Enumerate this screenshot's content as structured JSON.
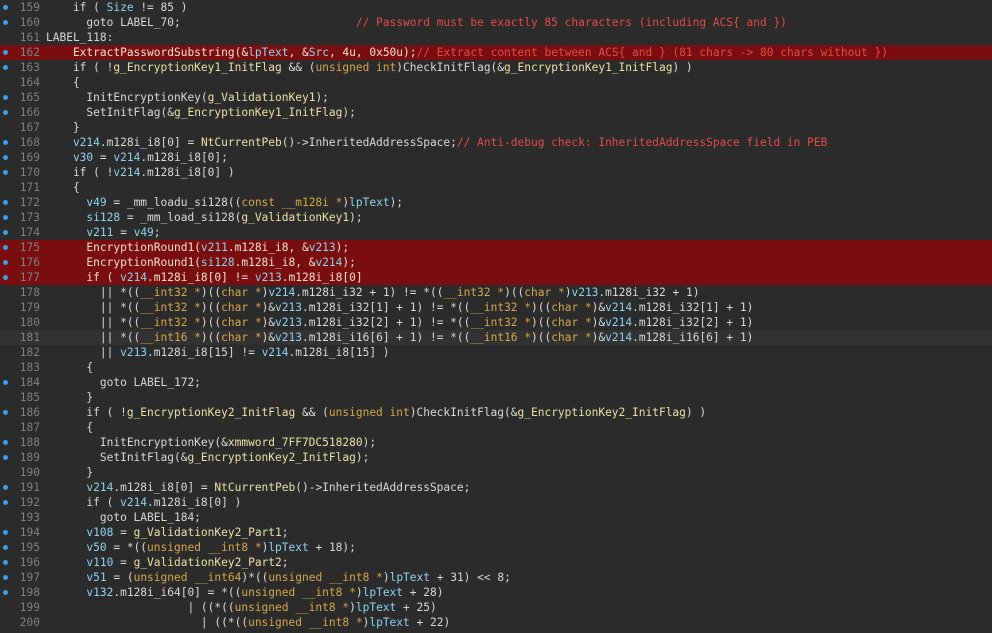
{
  "colors": {
    "background": "#2b2b2b",
    "highlight": "#7a0e0e",
    "line_number": "#7d8084",
    "breakpoint_dot": "#3a9fe6",
    "comment": "#e14c4c",
    "type": "#d4a84b",
    "variable": "#8fd3ef",
    "global": "#e8e2a8"
  },
  "lines": [
    {
      "n": "159",
      "dot": true,
      "hl": false,
      "tokens": [
        [
          "t",
          "    if ( "
        ],
        [
          "v",
          "Size"
        ],
        [
          "t",
          " != 85 )"
        ]
      ]
    },
    {
      "n": "160",
      "dot": true,
      "hl": false,
      "tokens": [
        [
          "t",
          "      goto LABEL_70;                          "
        ],
        [
          "c",
          "// Password must be exactly 85 characters (including ACS{ and })"
        ]
      ]
    },
    {
      "n": "161",
      "dot": false,
      "hl": false,
      "tokens": [
        [
          "t",
          "LABEL_118:"
        ]
      ]
    },
    {
      "n": "162",
      "dot": true,
      "hl": true,
      "tokens": [
        [
          "t",
          "    ExtractPasswordSubstring(&"
        ],
        [
          "v",
          "lpText"
        ],
        [
          "t",
          ", &"
        ],
        [
          "v",
          "Src"
        ],
        [
          "t",
          ", 4u, 0x50u);"
        ],
        [
          "c",
          "// Extract content between ACS{ and } (81 chars -> 80 chars without })"
        ]
      ]
    },
    {
      "n": "163",
      "dot": true,
      "hl": false,
      "tokens": [
        [
          "t",
          "    if ( !"
        ],
        [
          "g",
          "g_EncryptionKey1_InitFlag"
        ],
        [
          "t",
          " && ("
        ],
        [
          "y",
          "unsigned int"
        ],
        [
          "t",
          ")CheckInitFlag(&"
        ],
        [
          "g",
          "g_EncryptionKey1_InitFlag"
        ],
        [
          "t",
          ") )"
        ]
      ]
    },
    {
      "n": "164",
      "dot": false,
      "hl": false,
      "tokens": [
        [
          "t",
          "    {"
        ]
      ]
    },
    {
      "n": "165",
      "dot": true,
      "hl": false,
      "tokens": [
        [
          "t",
          "      InitEncryptionKey("
        ],
        [
          "g",
          "g_ValidationKey1"
        ],
        [
          "t",
          ");"
        ]
      ]
    },
    {
      "n": "166",
      "dot": true,
      "hl": false,
      "tokens": [
        [
          "t",
          "      SetInitFlag(&"
        ],
        [
          "g",
          "g_EncryptionKey1_InitFlag"
        ],
        [
          "t",
          ");"
        ]
      ]
    },
    {
      "n": "167",
      "dot": false,
      "hl": false,
      "tokens": [
        [
          "t",
          "    }"
        ]
      ]
    },
    {
      "n": "168",
      "dot": true,
      "hl": false,
      "tokens": [
        [
          "v",
          "    v214"
        ],
        [
          "t",
          ".m128i_i8[0] = "
        ],
        [
          "g",
          "NtCurrentPeb"
        ],
        [
          "t",
          "()->InheritedAddressSpace;"
        ],
        [
          "c",
          "// Anti-debug check: InheritedAddressSpace field in PEB"
        ]
      ]
    },
    {
      "n": "169",
      "dot": true,
      "hl": false,
      "tokens": [
        [
          "v",
          "    v30"
        ],
        [
          "t",
          " = "
        ],
        [
          "v",
          "v214"
        ],
        [
          "t",
          ".m128i_i8[0];"
        ]
      ]
    },
    {
      "n": "170",
      "dot": true,
      "hl": false,
      "tokens": [
        [
          "t",
          "    if ( !"
        ],
        [
          "v",
          "v214"
        ],
        [
          "t",
          ".m128i_i8[0] )"
        ]
      ]
    },
    {
      "n": "171",
      "dot": false,
      "hl": false,
      "tokens": [
        [
          "t",
          "    {"
        ]
      ]
    },
    {
      "n": "172",
      "dot": true,
      "hl": false,
      "tokens": [
        [
          "v",
          "      v49"
        ],
        [
          "t",
          " = _mm_loadu_si128(("
        ],
        [
          "y",
          "const __m128i *"
        ],
        [
          "t",
          ")"
        ],
        [
          "v",
          "lpText"
        ],
        [
          "t",
          ");"
        ]
      ]
    },
    {
      "n": "173",
      "dot": true,
      "hl": false,
      "tokens": [
        [
          "v",
          "      si128"
        ],
        [
          "t",
          " = _mm_load_si128("
        ],
        [
          "g",
          "g_ValidationKey1"
        ],
        [
          "t",
          ");"
        ]
      ]
    },
    {
      "n": "174",
      "dot": true,
      "hl": false,
      "tokens": [
        [
          "v",
          "      v211"
        ],
        [
          "t",
          " = "
        ],
        [
          "v",
          "v49"
        ],
        [
          "t",
          ";"
        ]
      ]
    },
    {
      "n": "175",
      "dot": true,
      "hl": true,
      "tokens": [
        [
          "t",
          "      EncryptionRound1("
        ],
        [
          "v",
          "v211"
        ],
        [
          "t",
          ".m128i_i8, &"
        ],
        [
          "v",
          "v213"
        ],
        [
          "t",
          ");"
        ]
      ]
    },
    {
      "n": "176",
      "dot": true,
      "hl": true,
      "tokens": [
        [
          "t",
          "      EncryptionRound1("
        ],
        [
          "v",
          "si128"
        ],
        [
          "t",
          ".m128i_i8, &"
        ],
        [
          "v",
          "v214"
        ],
        [
          "t",
          ");"
        ]
      ]
    },
    {
      "n": "177",
      "dot": true,
      "hl": true,
      "tokens": [
        [
          "t",
          "      if ( "
        ],
        [
          "v",
          "v214"
        ],
        [
          "t",
          ".m128i_i8[0] != "
        ],
        [
          "v",
          "v213"
        ],
        [
          "t",
          ".m128i_i8[0]"
        ]
      ]
    },
    {
      "n": "178",
      "dot": false,
      "hl": false,
      "tokens": [
        [
          "t",
          "        || *(("
        ],
        [
          "y",
          "__int32 *"
        ],
        [
          "t",
          ")(("
        ],
        [
          "y",
          "char *"
        ],
        [
          "t",
          ")"
        ],
        [
          "v",
          "v214"
        ],
        [
          "t",
          ".m128i_i32 + 1) != *(("
        ],
        [
          "y",
          "__int32 *"
        ],
        [
          "t",
          ")(("
        ],
        [
          "y",
          "char *"
        ],
        [
          "t",
          ")"
        ],
        [
          "v",
          "v213"
        ],
        [
          "t",
          ".m128i_i32 + 1)"
        ]
      ]
    },
    {
      "n": "179",
      "dot": false,
      "hl": false,
      "tokens": [
        [
          "t",
          "        || *(("
        ],
        [
          "y",
          "__int32 *"
        ],
        [
          "t",
          ")(("
        ],
        [
          "y",
          "char *"
        ],
        [
          "t",
          ")&"
        ],
        [
          "v",
          "v213"
        ],
        [
          "t",
          ".m128i_i32[1] + 1) != *(("
        ],
        [
          "y",
          "__int32 *"
        ],
        [
          "t",
          ")(("
        ],
        [
          "y",
          "char *"
        ],
        [
          "t",
          ")&"
        ],
        [
          "v",
          "v214"
        ],
        [
          "t",
          ".m128i_i32[1] + 1)"
        ]
      ]
    },
    {
      "n": "180",
      "dot": false,
      "hl": false,
      "tokens": [
        [
          "t",
          "        || *(("
        ],
        [
          "y",
          "__int32 *"
        ],
        [
          "t",
          ")(("
        ],
        [
          "y",
          "char *"
        ],
        [
          "t",
          ")&"
        ],
        [
          "v",
          "v213"
        ],
        [
          "t",
          ".m128i_i32[2] + 1) != *(("
        ],
        [
          "y",
          "__int32 *"
        ],
        [
          "t",
          ")(("
        ],
        [
          "y",
          "char *"
        ],
        [
          "t",
          ")&"
        ],
        [
          "v",
          "v214"
        ],
        [
          "t",
          ".m128i_i32[2] + 1)"
        ]
      ]
    },
    {
      "n": "181",
      "dot": false,
      "hl": false,
      "cur": true,
      "tokens": [
        [
          "t",
          "        || *(("
        ],
        [
          "y",
          "__int16 *"
        ],
        [
          "t",
          ")(("
        ],
        [
          "y",
          "char *"
        ],
        [
          "t",
          ")&"
        ],
        [
          "v",
          "v213"
        ],
        [
          "t",
          ".m128i_i16[6] + 1) != *(("
        ],
        [
          "y",
          "__int16 *"
        ],
        [
          "t",
          ")(("
        ],
        [
          "y",
          "char *"
        ],
        [
          "t",
          ")&"
        ],
        [
          "v",
          "v214"
        ],
        [
          "t",
          ".m128i_i16[6] + 1)"
        ]
      ]
    },
    {
      "n": "182",
      "dot": false,
      "hl": false,
      "tokens": [
        [
          "t",
          "        || "
        ],
        [
          "v",
          "v213"
        ],
        [
          "t",
          ".m128i_i8[15] != "
        ],
        [
          "v",
          "v214"
        ],
        [
          "t",
          ".m128i_i8[15] )"
        ]
      ]
    },
    {
      "n": "183",
      "dot": false,
      "hl": false,
      "tokens": [
        [
          "t",
          "      {"
        ]
      ]
    },
    {
      "n": "184",
      "dot": true,
      "hl": false,
      "tokens": [
        [
          "t",
          "        goto LABEL_172;"
        ]
      ]
    },
    {
      "n": "185",
      "dot": false,
      "hl": false,
      "tokens": [
        [
          "t",
          "      }"
        ]
      ]
    },
    {
      "n": "186",
      "dot": true,
      "hl": false,
      "tokens": [
        [
          "t",
          "      if ( !"
        ],
        [
          "g",
          "g_EncryptionKey2_InitFlag"
        ],
        [
          "t",
          " && ("
        ],
        [
          "y",
          "unsigned int"
        ],
        [
          "t",
          ")CheckInitFlag(&"
        ],
        [
          "g",
          "g_EncryptionKey2_InitFlag"
        ],
        [
          "t",
          ") )"
        ]
      ]
    },
    {
      "n": "187",
      "dot": false,
      "hl": false,
      "tokens": [
        [
          "t",
          "      {"
        ]
      ]
    },
    {
      "n": "188",
      "dot": true,
      "hl": false,
      "tokens": [
        [
          "t",
          "        InitEncryptionKey(&"
        ],
        [
          "g",
          "xmmword_7FF7DC518280"
        ],
        [
          "t",
          ");"
        ]
      ]
    },
    {
      "n": "189",
      "dot": true,
      "hl": false,
      "tokens": [
        [
          "t",
          "        SetInitFlag(&"
        ],
        [
          "g",
          "g_EncryptionKey2_InitFlag"
        ],
        [
          "t",
          ");"
        ]
      ]
    },
    {
      "n": "190",
      "dot": false,
      "hl": false,
      "tokens": [
        [
          "t",
          "      }"
        ]
      ]
    },
    {
      "n": "191",
      "dot": true,
      "hl": false,
      "tokens": [
        [
          "v",
          "      v214"
        ],
        [
          "t",
          ".m128i_i8[0] = "
        ],
        [
          "g",
          "NtCurrentPeb"
        ],
        [
          "t",
          "()->InheritedAddressSpace;"
        ]
      ]
    },
    {
      "n": "192",
      "dot": true,
      "hl": false,
      "tokens": [
        [
          "t",
          "      if ( "
        ],
        [
          "v",
          "v214"
        ],
        [
          "t",
          ".m128i_i8[0] )"
        ]
      ]
    },
    {
      "n": "193",
      "dot": false,
      "hl": false,
      "tokens": [
        [
          "t",
          "        goto LABEL_184;"
        ]
      ]
    },
    {
      "n": "194",
      "dot": true,
      "hl": false,
      "tokens": [
        [
          "v",
          "      v108"
        ],
        [
          "t",
          " = "
        ],
        [
          "g",
          "g_ValidationKey2_Part1"
        ],
        [
          "t",
          ";"
        ]
      ]
    },
    {
      "n": "195",
      "dot": true,
      "hl": false,
      "tokens": [
        [
          "v",
          "      v50"
        ],
        [
          "t",
          " = *(("
        ],
        [
          "y",
          "unsigned __int8 *"
        ],
        [
          "t",
          ")"
        ],
        [
          "v",
          "lpText"
        ],
        [
          "t",
          " + 18);"
        ]
      ]
    },
    {
      "n": "196",
      "dot": true,
      "hl": false,
      "tokens": [
        [
          "v",
          "      v110"
        ],
        [
          "t",
          " = "
        ],
        [
          "g",
          "g_ValidationKey2_Part2"
        ],
        [
          "t",
          ";"
        ]
      ]
    },
    {
      "n": "197",
      "dot": true,
      "hl": false,
      "tokens": [
        [
          "v",
          "      v51"
        ],
        [
          "t",
          " = ("
        ],
        [
          "y",
          "unsigned __int64"
        ],
        [
          "t",
          ")*(("
        ],
        [
          "y",
          "unsigned __int8 *"
        ],
        [
          "t",
          ")"
        ],
        [
          "v",
          "lpText"
        ],
        [
          "t",
          " + 31) << 8;"
        ]
      ]
    },
    {
      "n": "198",
      "dot": true,
      "hl": false,
      "tokens": [
        [
          "v",
          "      v132"
        ],
        [
          "t",
          ".m128i_i64[0] = *(("
        ],
        [
          "y",
          "unsigned __int8 *"
        ],
        [
          "t",
          ")"
        ],
        [
          "v",
          "lpText"
        ],
        [
          "t",
          " + 28)"
        ]
      ]
    },
    {
      "n": "199",
      "dot": false,
      "hl": false,
      "tokens": [
        [
          "t",
          "                     | ((*(("
        ],
        [
          "y",
          "unsigned __int8 *"
        ],
        [
          "t",
          ")"
        ],
        [
          "v",
          "lpText"
        ],
        [
          "t",
          " + 25)"
        ]
      ]
    },
    {
      "n": "200",
      "dot": false,
      "hl": false,
      "tokens": [
        [
          "t",
          "                       | ((*(("
        ],
        [
          "y",
          "unsigned __int8 *"
        ],
        [
          "t",
          ")"
        ],
        [
          "v",
          "lpText"
        ],
        [
          "t",
          " + 22)"
        ]
      ]
    }
  ]
}
